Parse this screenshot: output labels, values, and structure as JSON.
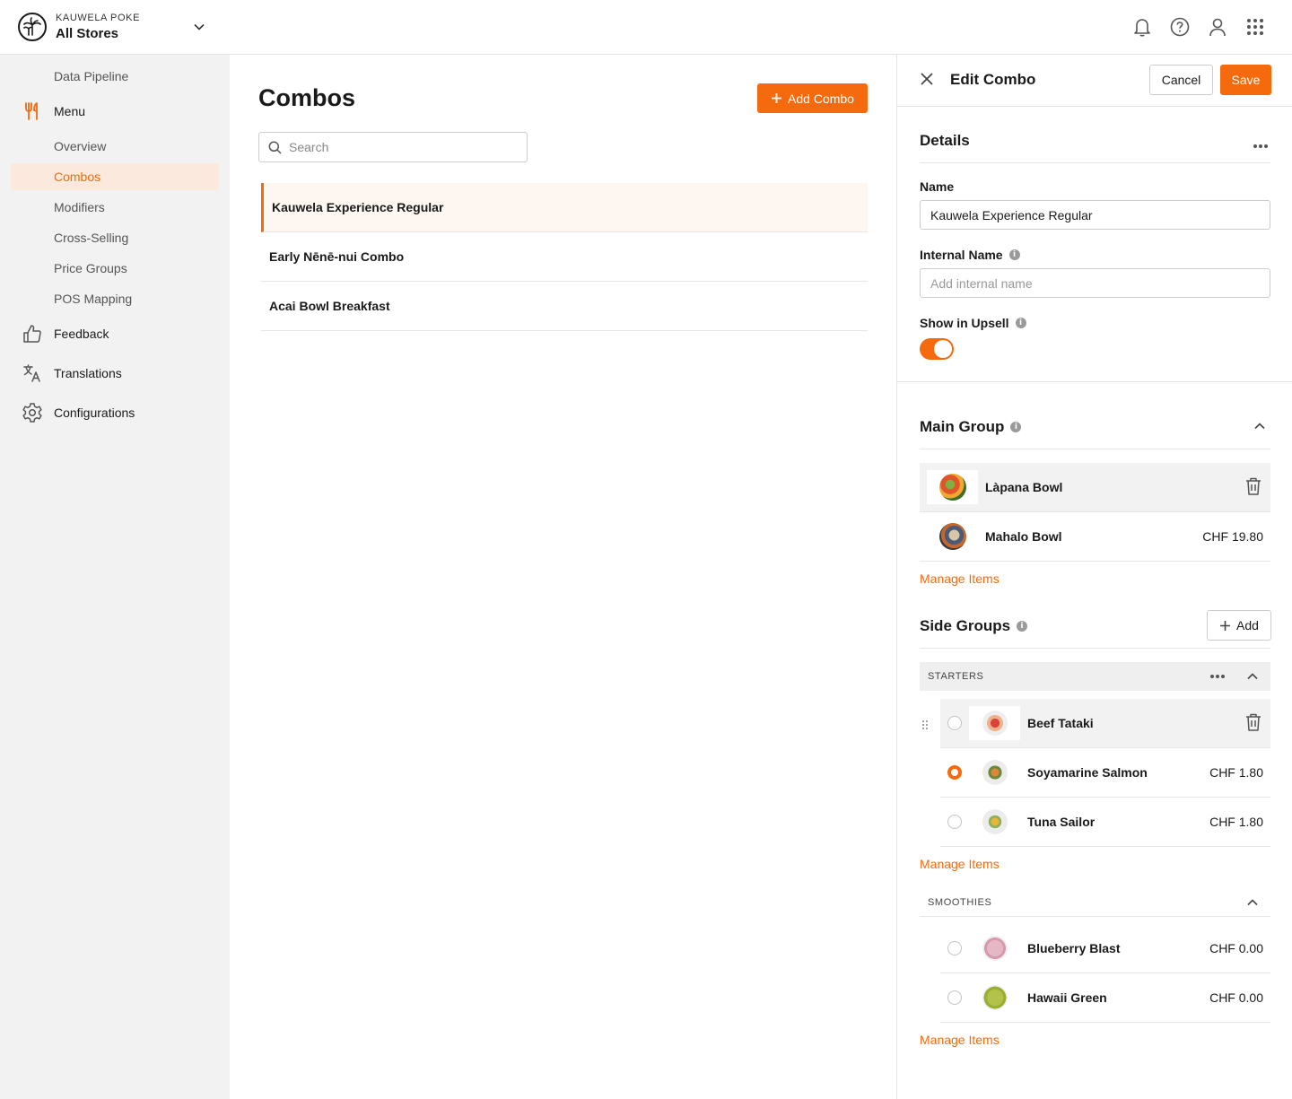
{
  "header": {
    "company": "KAUWELA POKE",
    "store": "All Stores"
  },
  "icons": {
    "notifications": "bell-icon",
    "help": "help-icon",
    "account": "user-icon",
    "apps": "grid-icon"
  },
  "sidebar": {
    "data_pipeline": "Data Pipeline",
    "menu": "Menu",
    "menu_items": [
      "Overview",
      "Combos",
      "Modifiers",
      "Cross-Selling",
      "Price Groups",
      "POS Mapping"
    ],
    "feedback": "Feedback",
    "translations": "Translations",
    "configurations": "Configurations",
    "active": "Combos"
  },
  "main": {
    "title": "Combos",
    "add_button": "Add Combo",
    "search_placeholder": "Search",
    "combos": [
      "Kauwela Experience Regular",
      "Early Nēnē-nui Combo",
      "Acai Bowl Breakfast"
    ]
  },
  "panel": {
    "title": "Edit Combo",
    "cancel": "Cancel",
    "save": "Save",
    "details": {
      "title": "Details",
      "name_label": "Name",
      "name_value": "Kauwela Experience Regular",
      "internal_label": "Internal Name",
      "internal_placeholder": "Add internal name",
      "upsell_label": "Show in Upsell",
      "upsell_on": true
    },
    "main_group": {
      "title": "Main Group",
      "items": [
        {
          "name": "Làpana Bowl",
          "price": ""
        },
        {
          "name": "Mahalo Bowl",
          "price": "CHF 19.80"
        }
      ],
      "manage": "Manage Items"
    },
    "side_groups": {
      "title": "Side Groups",
      "add": "Add",
      "groups": [
        {
          "name": "STARTERS",
          "items": [
            {
              "name": "Beef Tataki",
              "price": "",
              "selected": false
            },
            {
              "name": "Soyamarine Salmon",
              "price": "CHF 1.80",
              "selected": true
            },
            {
              "name": "Tuna Sailor",
              "price": "CHF 1.80",
              "selected": false
            }
          ],
          "manage": "Manage Items"
        },
        {
          "name": "SMOOTHIES",
          "items": [
            {
              "name": "Blueberry Blast",
              "price": "CHF 0.00",
              "selected": false
            },
            {
              "name": "Hawaii Green",
              "price": "CHF 0.00",
              "selected": false
            }
          ],
          "manage": "Manage Items"
        }
      ]
    }
  },
  "colors": {
    "accent": "#f56a0d",
    "sidebar_bg": "#f2f2f2",
    "active_bg": "#fbe9de"
  }
}
